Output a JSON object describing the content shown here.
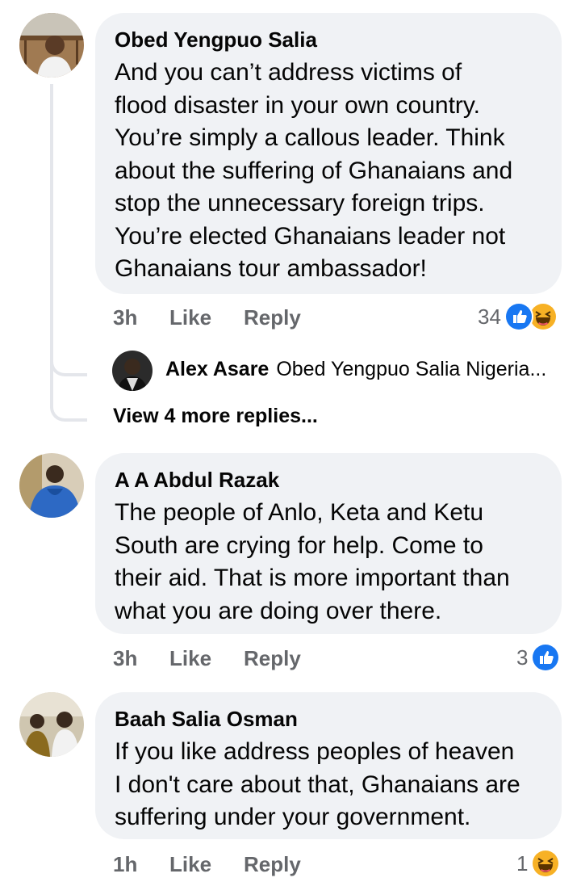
{
  "comments": [
    {
      "author": "Obed Yengpuo Salia",
      "text": "And you can’t address victims of\nflood disaster in your own country.\nYou’re simply a callous leader. Think\nabout the suffering of Ghanaians and\nstop the unnecessary foreign trips.\nYou’re elected Ghanaians leader not\nGhanaians tour ambassador!",
      "time": "3h",
      "like_label": "Like",
      "reply_label": "Reply",
      "reaction_count": "34",
      "reactions": [
        "like-icon",
        "haha-icon"
      ]
    },
    {
      "author": "A A Abdul Razak",
      "text": "The people of Anlo, Keta and Ketu\nSouth are crying for help. Come to\ntheir aid. That is more important than\nwhat you are doing over there.",
      "time": "3h",
      "like_label": "Like",
      "reply_label": "Reply",
      "reaction_count": "3",
      "reactions": [
        "like-icon"
      ]
    },
    {
      "author": "Baah Salia Osman",
      "text": "If you like address peoples of heaven\nI don't care about that, Ghanaians are\nsuffering under your government.",
      "time": "1h",
      "like_label": "Like",
      "reply_label": "Reply",
      "reaction_count": "1",
      "reactions": [
        "haha-icon"
      ]
    }
  ],
  "reply_preview": {
    "author": "Alex Asare",
    "text": "Obed Yengpuo Salia Nigeria..."
  },
  "view_more": "View 4 more replies...",
  "colors": {
    "like_blue": "#1877f2",
    "haha_yellow": "#f7b125",
    "bubble_bg": "#f0f2f5",
    "meta_gray": "#65676b"
  }
}
